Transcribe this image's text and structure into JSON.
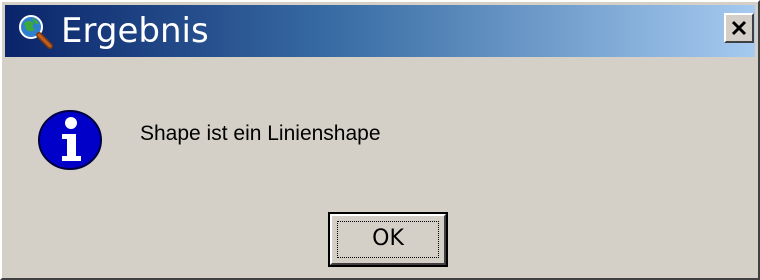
{
  "window": {
    "title": "Ergebnis",
    "title_icon": "magnifier-globe-icon",
    "close_label": "close",
    "close_icon": "close-x-icon"
  },
  "message": {
    "icon": "info-icon",
    "text": "Shape ist ein Linienshape"
  },
  "buttons": {
    "ok_label": "OK"
  },
  "colors": {
    "dialog_bg": "#d4d0c8",
    "title_start": "#0a246a",
    "title_end": "#a6caf0",
    "info_blue": "#0000c8"
  }
}
